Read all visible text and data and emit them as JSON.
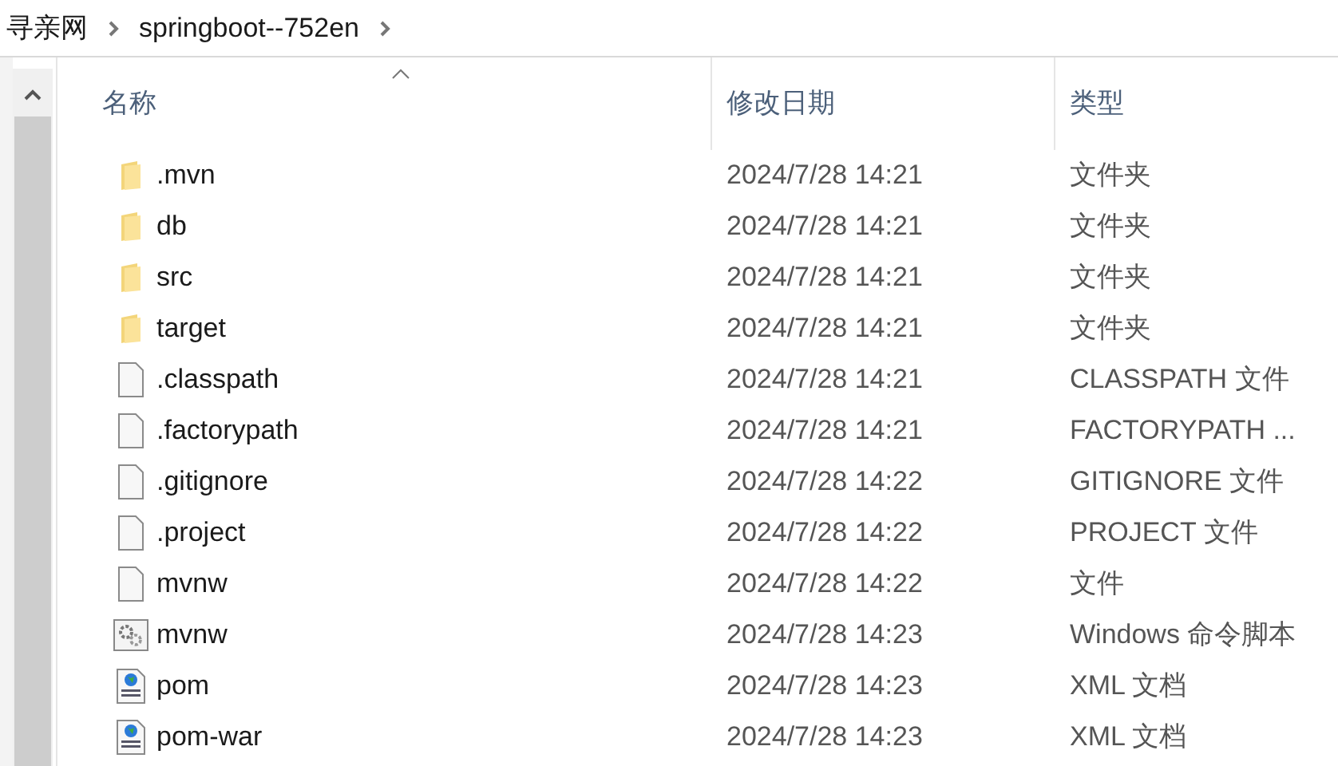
{
  "breadcrumb": [
    "寻亲网",
    "springboot--752en"
  ],
  "table": {
    "columns": [
      "名称",
      "修改日期",
      "类型"
    ],
    "rows": [
      {
        "kind": "folder",
        "name": ".mvn",
        "date": "2024/7/28 14:21",
        "type": "文件夹"
      },
      {
        "kind": "folder",
        "name": "db",
        "date": "2024/7/28 14:21",
        "type": "文件夹"
      },
      {
        "kind": "folder",
        "name": "src",
        "date": "2024/7/28 14:21",
        "type": "文件夹"
      },
      {
        "kind": "folder",
        "name": "target",
        "date": "2024/7/28 14:21",
        "type": "文件夹"
      },
      {
        "kind": "file",
        "name": ".classpath",
        "date": "2024/7/28 14:21",
        "type": "CLASSPATH 文件"
      },
      {
        "kind": "file",
        "name": ".factorypath",
        "date": "2024/7/28 14:21",
        "type": "FACTORYPATH ..."
      },
      {
        "kind": "file",
        "name": ".gitignore",
        "date": "2024/7/28 14:22",
        "type": "GITIGNORE 文件"
      },
      {
        "kind": "file",
        "name": ".project",
        "date": "2024/7/28 14:22",
        "type": "PROJECT 文件"
      },
      {
        "kind": "file",
        "name": "mvnw",
        "date": "2024/7/28 14:22",
        "type": "文件"
      },
      {
        "kind": "script",
        "name": "mvnw",
        "date": "2024/7/28 14:23",
        "type": "Windows 命令脚本"
      },
      {
        "kind": "xml",
        "name": "pom",
        "date": "2024/7/28 14:23",
        "type": "XML 文档"
      },
      {
        "kind": "xml",
        "name": "pom-war",
        "date": "2024/7/28 14:23",
        "type": "XML 文档"
      }
    ]
  }
}
